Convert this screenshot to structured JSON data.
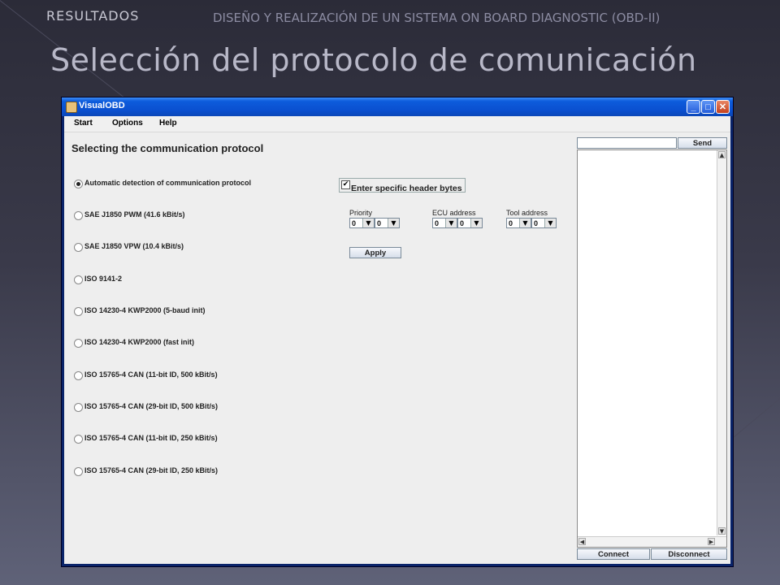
{
  "slide": {
    "header_left": "RESULTADOS",
    "header_right": "DISEÑO Y REALIZACIÓN DE UN SISTEMA ON BOARD DIAGNOSTIC (OBD-II)",
    "title": "Selección del protocolo de comunicación"
  },
  "window": {
    "title": "VisualOBD",
    "min_glyph": "_",
    "max_glyph": "□",
    "close_glyph": "✕"
  },
  "menu": {
    "items": [
      "Start",
      "Options",
      "Help"
    ]
  },
  "main": {
    "heading": "Selecting the communication protocol",
    "protocols": [
      "Automatic detection of communication protocol",
      "SAE J1850 PWM (41.6 kBit/s)",
      "SAE J1850 VPW (10.4 kBit/s)",
      "ISO 9141-2",
      "ISO 14230-4 KWP2000 (5-baud init)",
      "ISO 14230-4 KWP2000 (fast init)",
      "ISO 15765-4 CAN (11-bit ID, 500 kBit/s)",
      "ISO 15765-4 CAN (29-bit ID, 500 kBit/s)",
      "ISO 15765-4 CAN (11-bit ID, 250 kBit/s)",
      "ISO 15765-4 CAN (29-bit ID, 250 kBit/s)"
    ],
    "selected_protocol_index": 0,
    "header_checkbox": {
      "label": "Enter specific header bytes",
      "checked": true,
      "mark": "✔"
    },
    "fields": {
      "priority": {
        "label": "Priority",
        "values": [
          "0",
          "0"
        ]
      },
      "ecu_address": {
        "label": "ECU address",
        "values": [
          "0",
          "0"
        ]
      },
      "tool_address": {
        "label": "Tool address",
        "values": [
          "0",
          "0"
        ]
      }
    },
    "apply_label": "Apply"
  },
  "console": {
    "input_value": "",
    "send_label": "Send",
    "connect_label": "Connect",
    "disconnect_label": "Disconnect"
  },
  "icons": {
    "dropdown": "▼",
    "scroll_up": "▲",
    "scroll_down": "▼",
    "scroll_left": "◀",
    "scroll_right": "▶"
  }
}
